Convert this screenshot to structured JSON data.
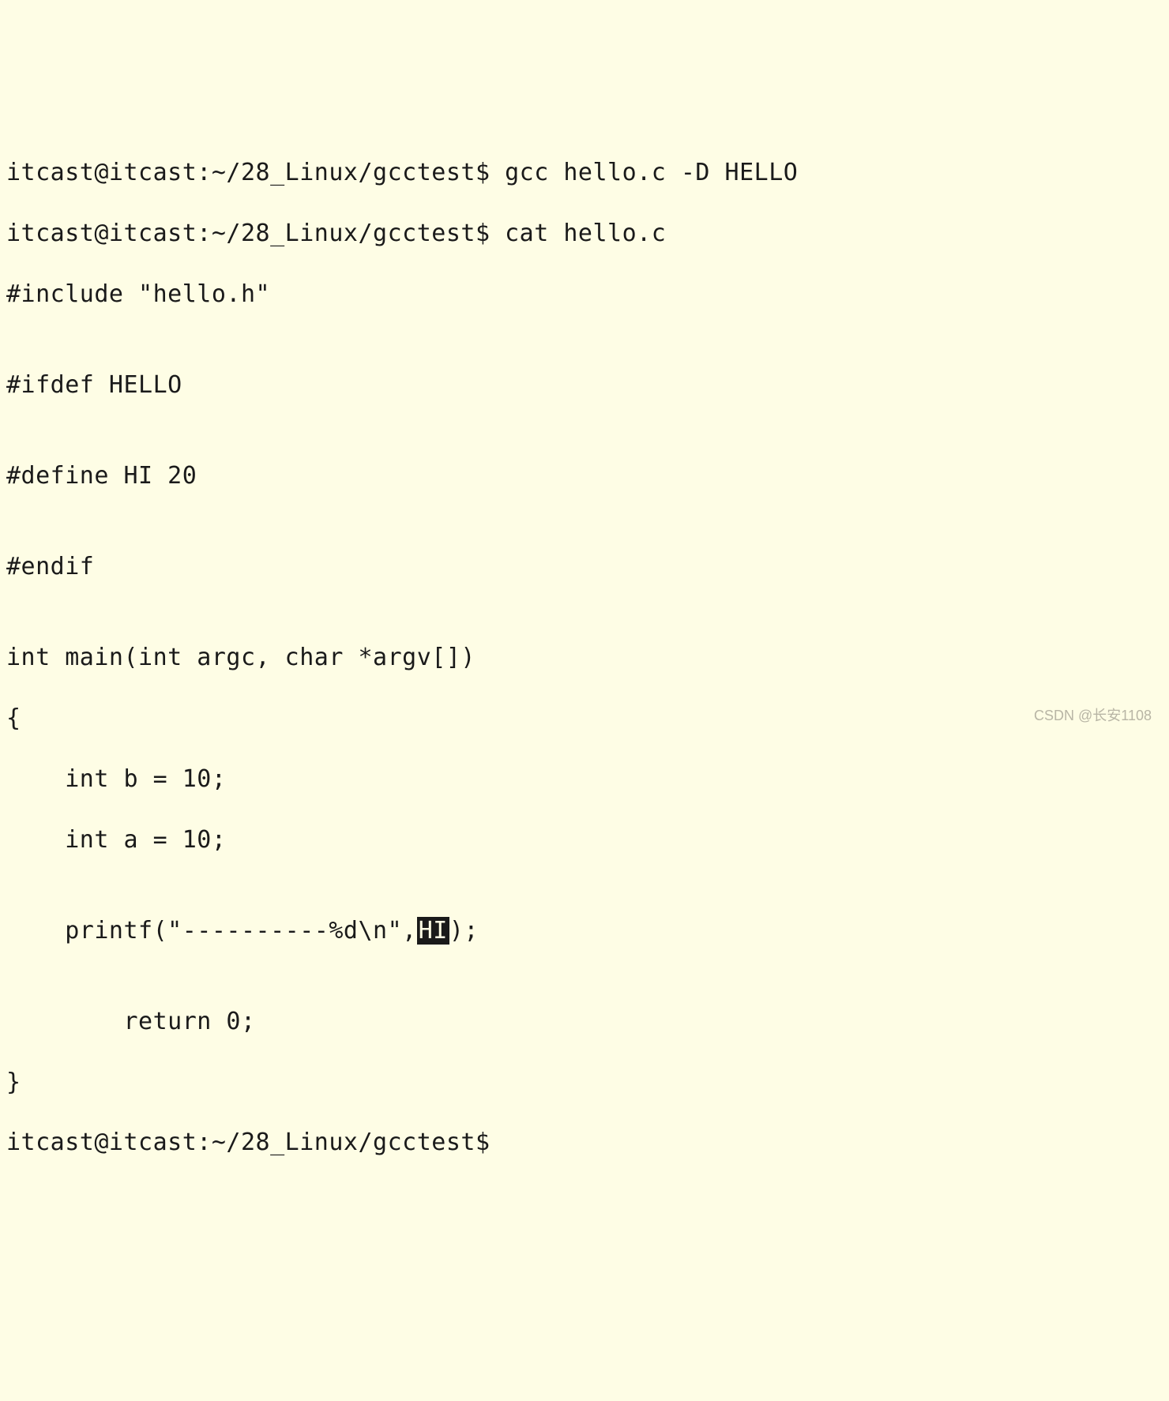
{
  "terminal": {
    "prompt": "itcast@itcast:~/28_Linux/gcctest$",
    "cmd1": "gcc hello.c -D HELLO",
    "cmd2": "cat hello.c",
    "source": {
      "line1": "#include \"hello.h\"",
      "line2": "",
      "line3": "#ifdef HELLO",
      "line4": "",
      "line5": "#define HI 20",
      "line6": "",
      "line7": "#endif",
      "line8": "",
      "line9": "int main(int argc, char *argv[])",
      "line10": "{",
      "line11": "    int b = 10;",
      "line12": "    int a = 10;",
      "line13": "",
      "line14_prefix": "    printf(\"----------%d\\n\",",
      "line14_highlight": "HI",
      "line14_suffix": ");",
      "line15": "",
      "line16": "        return 0;",
      "line17": "}"
    }
  },
  "watermark": "CSDN @长安1108"
}
